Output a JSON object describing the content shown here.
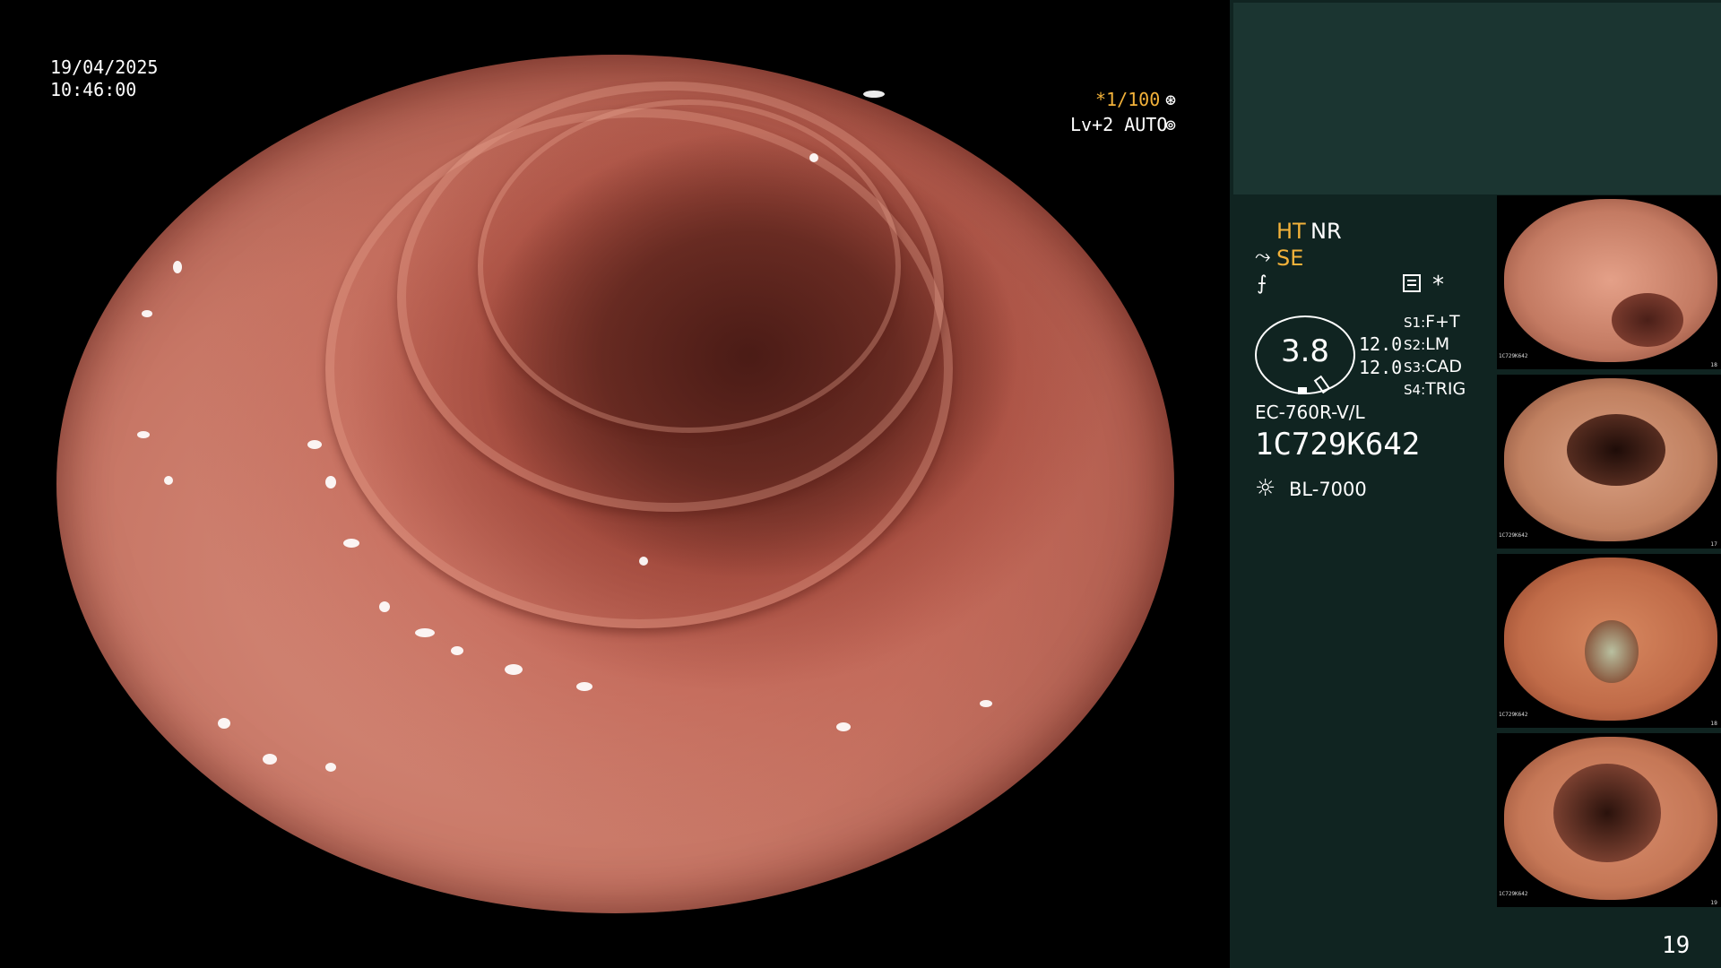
{
  "osd": {
    "date": "19/04/2025",
    "time": "10:46:00",
    "shutter": "*1/100",
    "shutter_icon": "⊛",
    "level": "Lv+2 AUTO",
    "level_icon": "⊚"
  },
  "panel": {
    "ht": "HT",
    "nr": "NR",
    "se_icon": "⤳",
    "se": "SE",
    "f_icon": "⨍",
    "star": "*",
    "gauge_value": "3.8",
    "value1": "12.0",
    "value2": "12.0",
    "slots": [
      {
        "key": "S1:",
        "value": "F+T"
      },
      {
        "key": "S2:",
        "value": "LM"
      },
      {
        "key": "S3:",
        "value": "CAD"
      },
      {
        "key": "S4:",
        "value": "TRIG"
      }
    ],
    "scope_model": "EC-760R-V/L",
    "serial": "1C729K642",
    "light_icon": "☼",
    "light_source": "BL-7000",
    "page_number": "19"
  },
  "colors": {
    "accent": "#f3b23a",
    "panel_bg": "#102421",
    "panel_top_bg": "#1b3531"
  },
  "thumbnails": [
    {
      "caption_line1": "1C729K642",
      "number": "18"
    },
    {
      "caption_line1": "1C729K642",
      "number": "17"
    },
    {
      "caption_line1": "1C729K642",
      "number": "18"
    },
    {
      "caption_line1": "1C729K642",
      "number": "19"
    }
  ]
}
